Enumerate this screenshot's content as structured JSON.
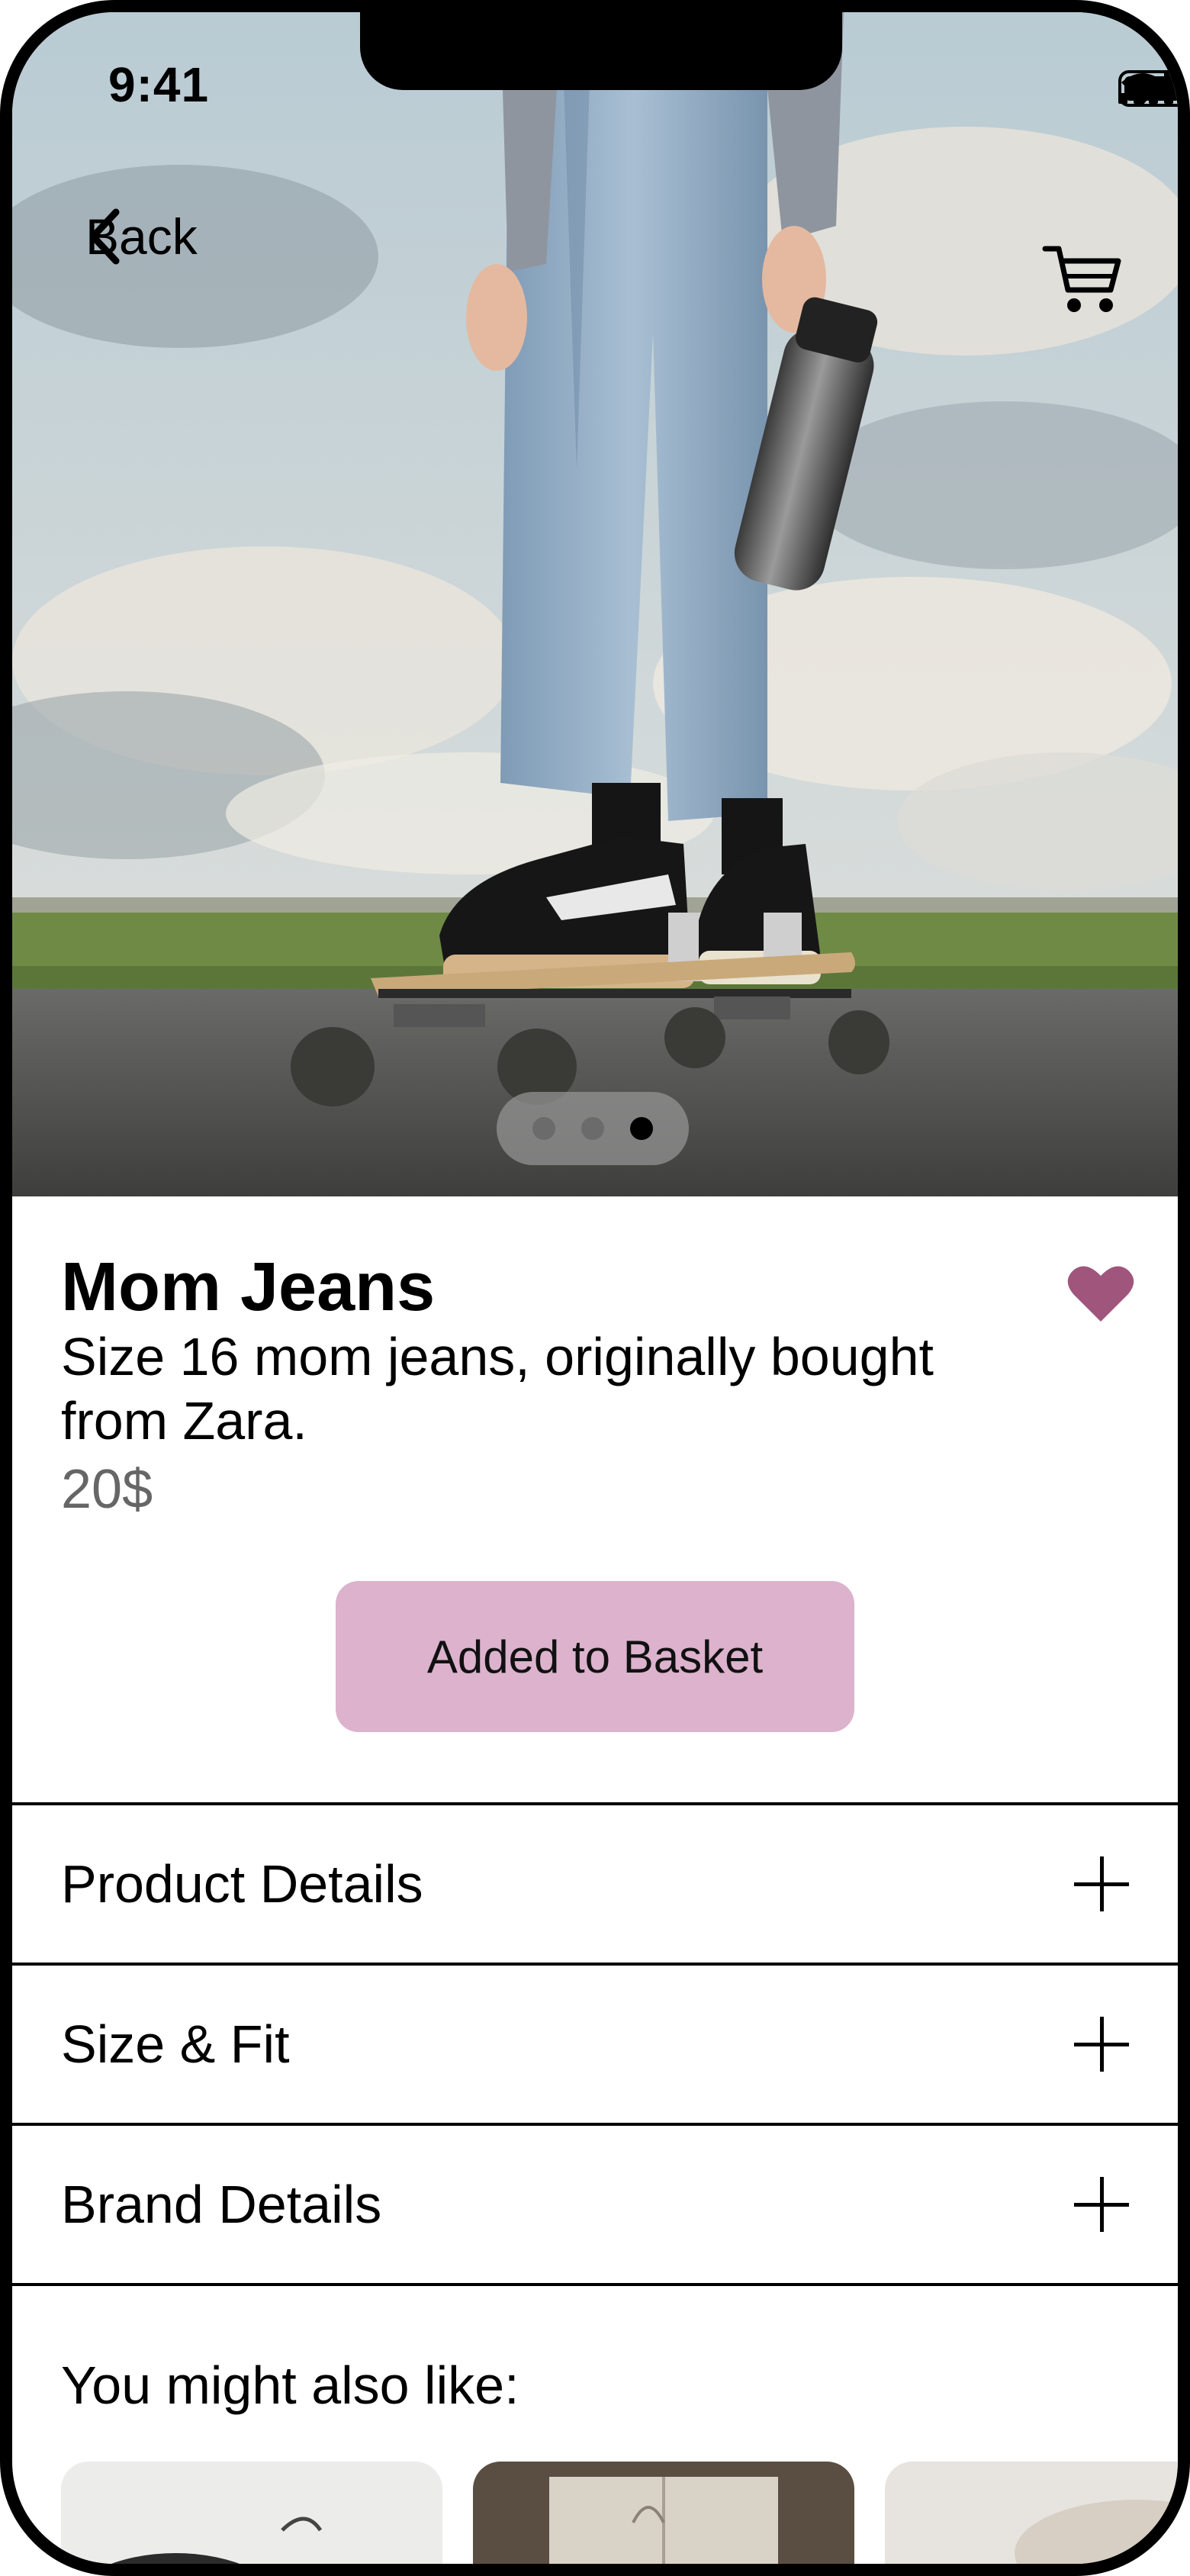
{
  "status_bar": {
    "time": "9:41"
  },
  "nav": {
    "back_label": "Back"
  },
  "gallery": {
    "page_count": 3,
    "active_page": 3
  },
  "product": {
    "title": "Mom Jeans",
    "description": "Size 16 mom jeans, originally bought from Zara.",
    "price": "20$",
    "favorited": true,
    "basket_label": "Added to Basket"
  },
  "details": {
    "sections": [
      {
        "label": "Product Details"
      },
      {
        "label": "Size & Fit"
      },
      {
        "label": "Brand Details"
      }
    ]
  },
  "recommendations": {
    "heading": "You might also like:"
  },
  "colors": {
    "accent": "#dcb2cd",
    "heart": "#a0557c",
    "price": "#666666"
  }
}
